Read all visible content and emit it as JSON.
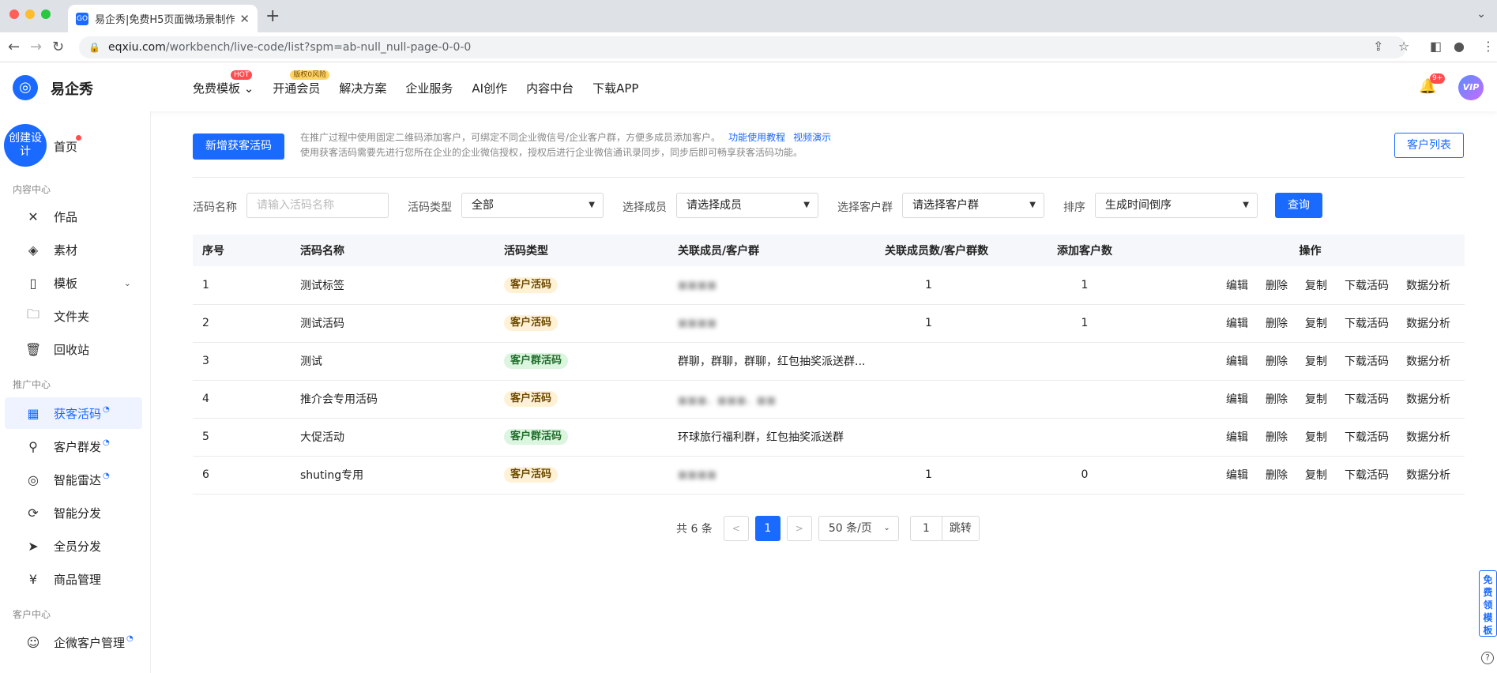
{
  "browser": {
    "tab_title": "易企秀|免费H5页面微场景制作",
    "url_host": "eqxiu.com",
    "url_path": "/workbench/live-code/list?spm=ab-null_null-page-0-0-0",
    "favicon_text": "GO"
  },
  "header": {
    "brand": "易企秀",
    "nav": [
      {
        "label": "免费模板 ⌄",
        "badge": "HOT"
      },
      {
        "label": "开通会员",
        "badge": "版权0风险"
      },
      {
        "label": "解决方案"
      },
      {
        "label": "企业服务"
      },
      {
        "label": "AI创作"
      },
      {
        "label": "内容中台"
      },
      {
        "label": "下载APP"
      }
    ],
    "bell_badge": "9+",
    "vip_label": "VIP"
  },
  "sidebar": {
    "create_label": "创建设计",
    "home_label": "首页",
    "section_content": "内容中心",
    "section_promote": "推广中心",
    "section_customer": "客户中心",
    "items": [
      {
        "label": "作品",
        "icon": "works-icon"
      },
      {
        "label": "素材",
        "icon": "layers-icon"
      },
      {
        "label": "模板",
        "icon": "template-icon"
      },
      {
        "label": "文件夹",
        "icon": "folder-icon"
      },
      {
        "label": "回收站",
        "icon": "trash-icon"
      },
      {
        "label": "获客活码",
        "icon": "qrcode-icon"
      },
      {
        "label": "客户群发",
        "icon": "user-send-icon"
      },
      {
        "label": "智能雷达",
        "icon": "radar-icon"
      },
      {
        "label": "智能分发",
        "icon": "distribute-icon"
      },
      {
        "label": "全员分发",
        "icon": "paper-plane-icon"
      },
      {
        "label": "商品管理",
        "icon": "goods-icon"
      },
      {
        "label": "企微客户管理",
        "icon": "contact-icon"
      }
    ]
  },
  "main": {
    "add_button": "新增获客活码",
    "tip_line1": "在推广过程中使用固定二维码添加客户，可绑定不同企业微信号/企业客户群，方便多成员添加客户。",
    "tip_link1": "功能使用教程",
    "tip_link2": "视频演示",
    "tip_line2": "使用获客活码需要先进行您所在企业的企业微信授权，授权后进行企业微信通讯录同步，同步后即可畅享获客活码功能。",
    "customer_list_button": "客户列表"
  },
  "filters": {
    "name_label": "活码名称",
    "name_placeholder": "请输入活码名称",
    "type_label": "活码类型",
    "type_value": "全部",
    "member_label": "选择成员",
    "member_value": "请选择成员",
    "group_label": "选择客户群",
    "group_value": "请选择客户群",
    "sort_label": "排序",
    "sort_value": "生成时间倒序",
    "query_button": "查询"
  },
  "table": {
    "headers": [
      "序号",
      "活码名称",
      "活码类型",
      "关联成员/客户群",
      "关联成员数/客户群数",
      "添加客户数",
      "操作"
    ],
    "ops": [
      "编辑",
      "删除",
      "复制",
      "下载活码",
      "数据分析"
    ],
    "rows": [
      {
        "no": "1",
        "name": "测试标签",
        "type": "客户活码",
        "kind": "y",
        "members": "■■■■",
        "blur": true,
        "count": "1",
        "added": "1"
      },
      {
        "no": "2",
        "name": "测试活码",
        "type": "客户活码",
        "kind": "y",
        "members": "■■■■",
        "blur": true,
        "count": "1",
        "added": "1"
      },
      {
        "no": "3",
        "name": "测试",
        "type": "客户群活码",
        "kind": "g",
        "members": "群聊，群聊，群聊，红包抽奖派送群...",
        "blur": false,
        "count": "",
        "added": ""
      },
      {
        "no": "4",
        "name": "推介会专用活码",
        "type": "客户活码",
        "kind": "y",
        "members": "■■■，■■■，■■",
        "blur": true,
        "count": "",
        "added": ""
      },
      {
        "no": "5",
        "name": "大促活动",
        "type": "客户群活码",
        "kind": "g",
        "members": "环球旅行福利群，红包抽奖派送群",
        "blur": false,
        "count": "",
        "added": ""
      },
      {
        "no": "6",
        "name": "shuting专用",
        "type": "客户活码",
        "kind": "y",
        "members": "■■■■",
        "blur": true,
        "count": "1",
        "added": "0"
      }
    ]
  },
  "pagination": {
    "total": "共 6 条",
    "prev": "<",
    "current": "1",
    "next": ">",
    "page_size": "50 条/页",
    "jump_value": "1",
    "jump_button": "跳转"
  },
  "float_box": "免费领模板",
  "help_icon": "?"
}
